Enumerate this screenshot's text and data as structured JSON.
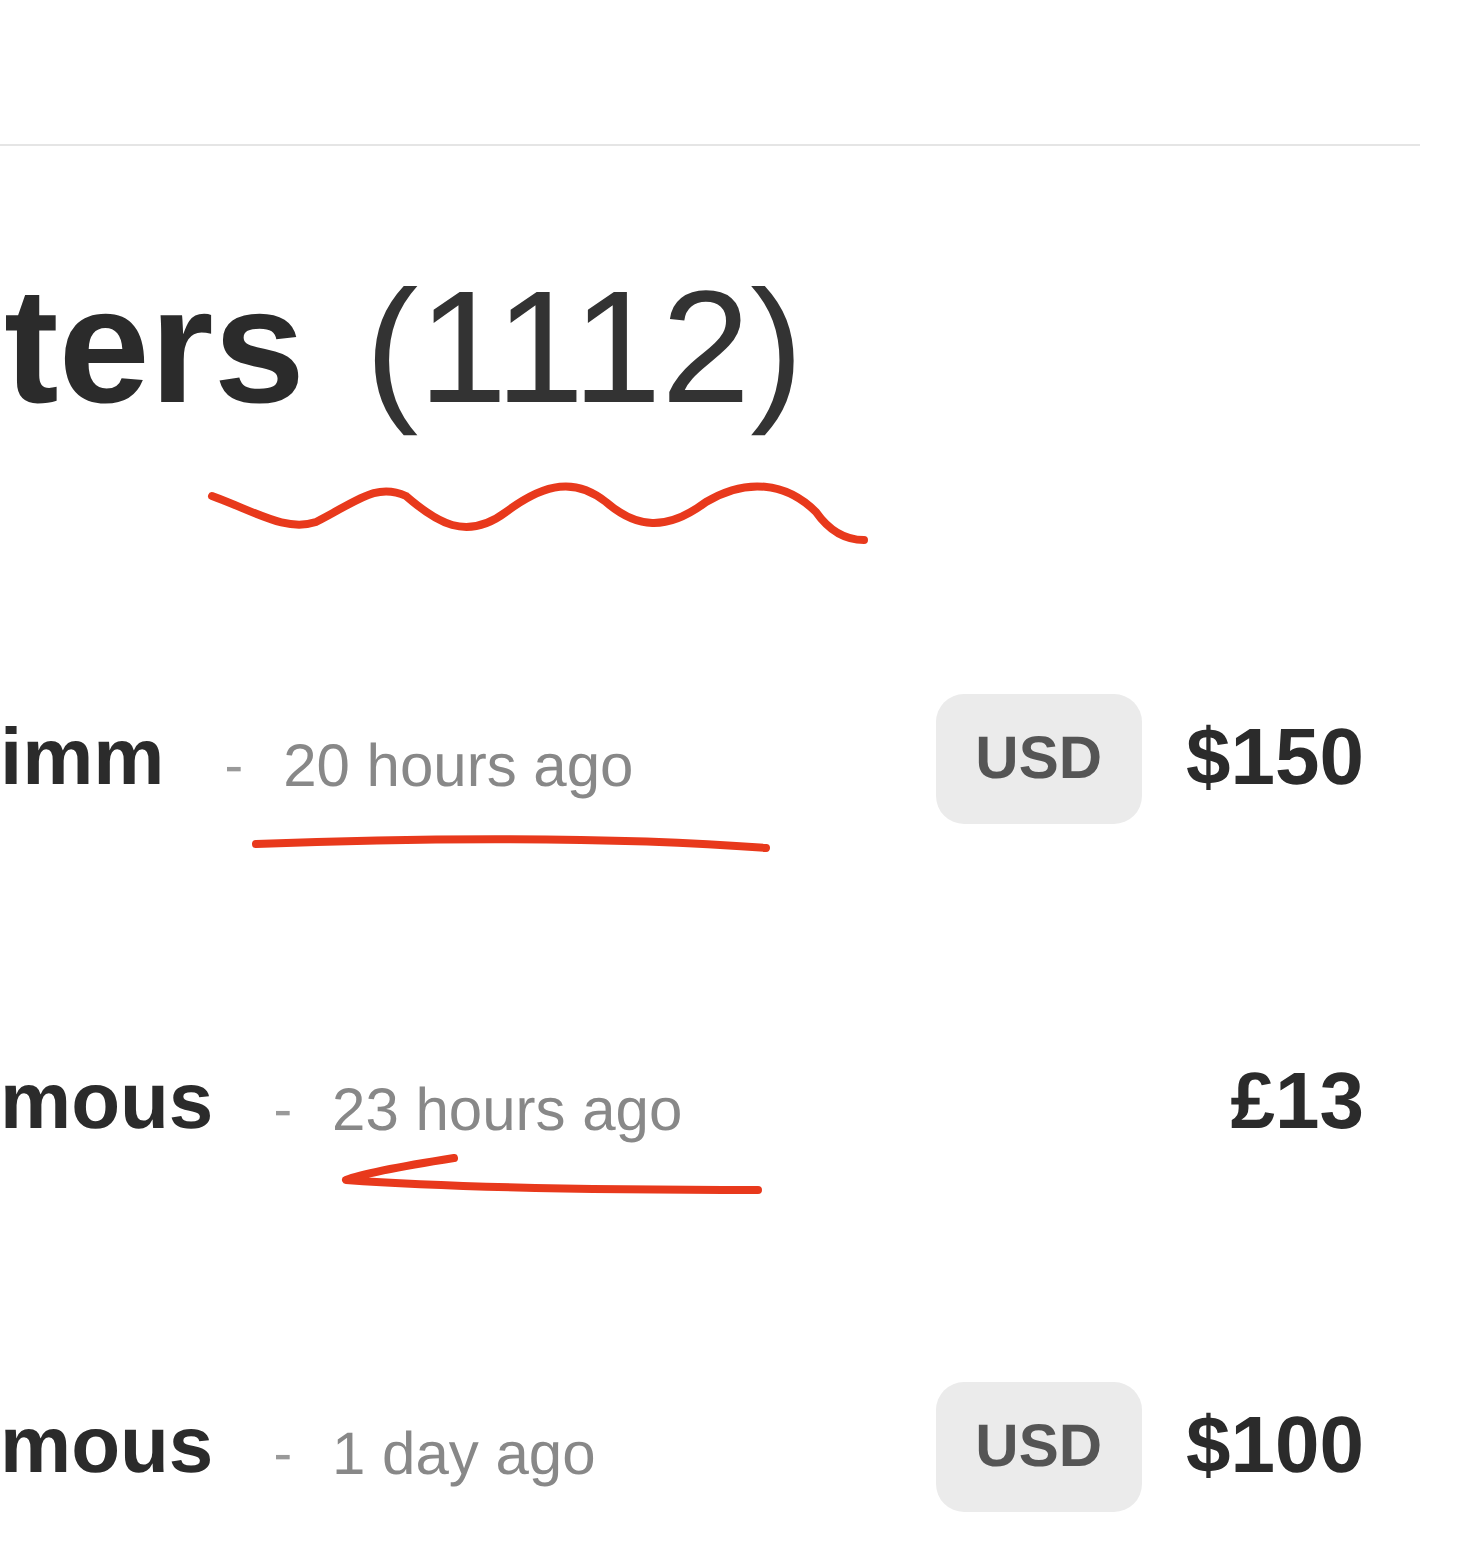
{
  "header": {
    "title": "ters",
    "count": "(1112)"
  },
  "supporters": [
    {
      "name": "imm",
      "separator": "-",
      "time": "20 hours ago",
      "currency": "USD",
      "amount": "$150"
    },
    {
      "name": "mous",
      "separator": "-",
      "time": "23 hours ago",
      "amount": "£13"
    },
    {
      "name": "mous",
      "separator": "-",
      "time": "1 day ago",
      "currency": "USD",
      "amount": "$100"
    }
  ]
}
